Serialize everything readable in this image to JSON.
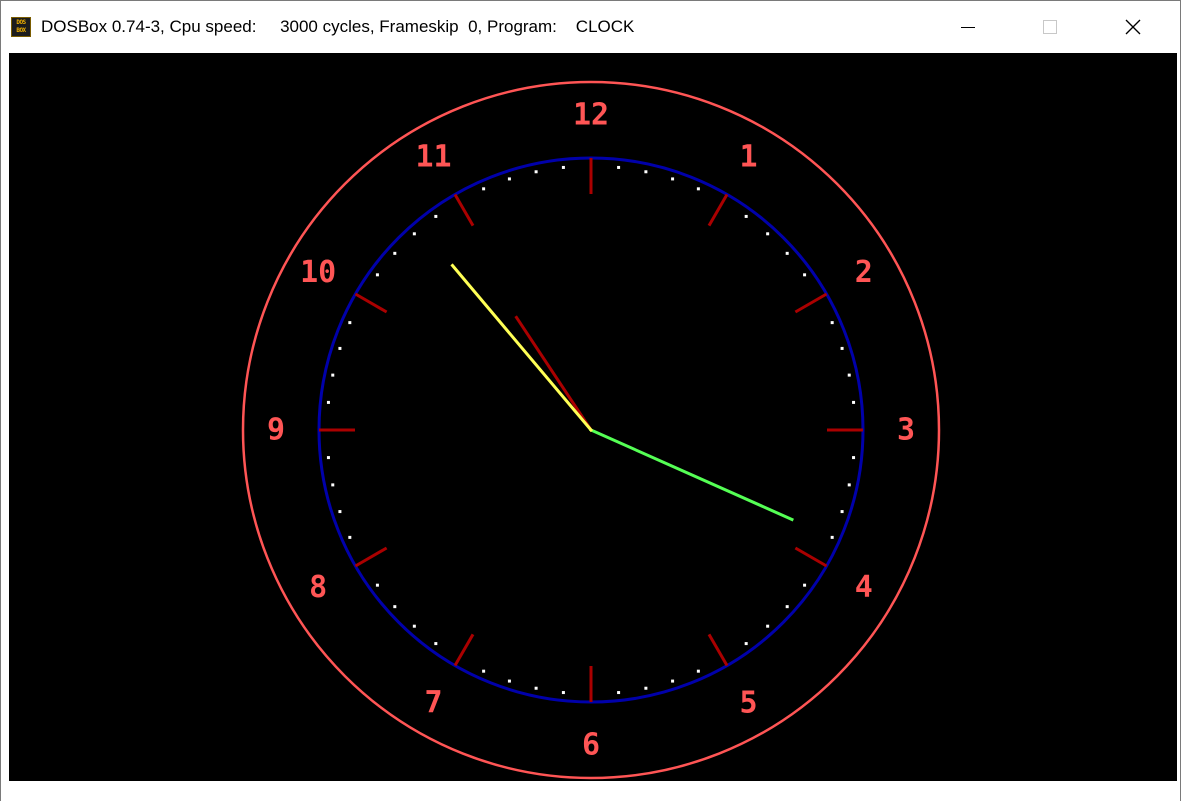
{
  "window": {
    "title": "DOSBox 0.74-3, Cpu speed:     3000 cycles, Frameskip  0, Program:    CLOCK",
    "icon_text_top": "DOS",
    "icon_text_bottom": "BOX",
    "buttons": [
      "minimize-icon",
      "maximize-icon",
      "close-icon"
    ]
  },
  "clock": {
    "numerals": [
      "12",
      "1",
      "2",
      "3",
      "4",
      "5",
      "6",
      "7",
      "8",
      "9",
      "10",
      "11"
    ],
    "time": {
      "hour": 10,
      "minute": 53,
      "second": 19
    },
    "colors": {
      "background": "#000000",
      "outer_ring": "#ff5555",
      "inner_ring": "#0000aa",
      "numerals": "#ff5555",
      "hour_ticks": "#aa0000",
      "minute_dots": "#ffffff",
      "hour_hand": "#aa0000",
      "minute_hand": "#ffff55",
      "second_hand": "#55ff55"
    }
  }
}
